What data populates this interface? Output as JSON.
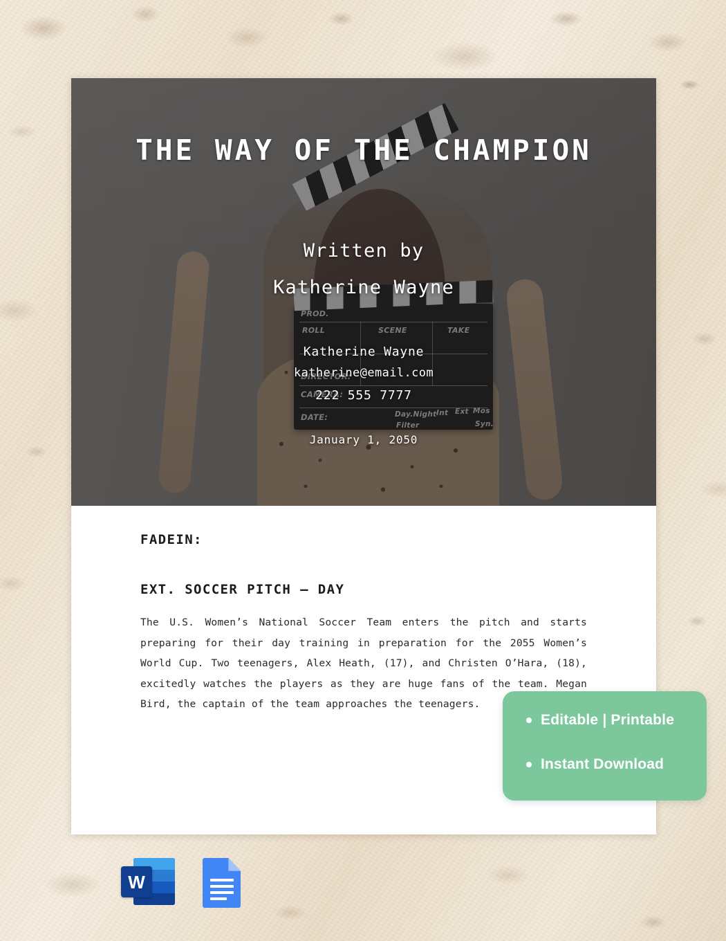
{
  "background": {
    "texture_name": "beige-stone-texture",
    "base_color": "#eadfcc"
  },
  "document": {
    "hero": {
      "photo_name": "woman-holding-clapperboard-photo",
      "overlay_color": "#2d2c2b",
      "title": "THE WAY OF THE CHAMPION",
      "written_by_label": "Written by",
      "author": "Katherine Wayne",
      "contact": {
        "name": "Katherine Wayne",
        "email": "katherine@email.com",
        "phone": "222 555 7777",
        "date": "January 1, 2050"
      },
      "clapperboard": {
        "prod_label": "PROD.",
        "roll_label": "ROLL",
        "scene_label": "SCENE",
        "take_label": "TAKE",
        "director_label": "DIRECTOR:",
        "camera_label": "CAMERA:",
        "date_label": "DATE:",
        "daynight_label": "Day.Night",
        "int_label": "Int",
        "ext_label": "Ext",
        "mos_label": "Mos",
        "filter_label": "Filter",
        "syn_label": "Syn."
      }
    },
    "script": {
      "fade_in": "FADEIN:",
      "scene_heading": "EXT. SOCCER PITCH – DAY",
      "action": "The U.S. Women’s National Soccer Team enters the pitch and starts preparing for their day training in preparation for the 2055 Women’s World Cup. Two teenagers, Alex Heath, (17), and Christen O’Hara, (18), excitedly watches the players as they are huge fans of the team. Megan Bird, the captain of the team approaches the teenagers."
    }
  },
  "promo_badge": {
    "color": "#7cc79b",
    "items": [
      "Editable | Printable",
      "Instant Download"
    ]
  },
  "app_icons": [
    {
      "name": "microsoft-word-icon",
      "letter": "W"
    },
    {
      "name": "google-docs-icon",
      "letter": ""
    }
  ]
}
